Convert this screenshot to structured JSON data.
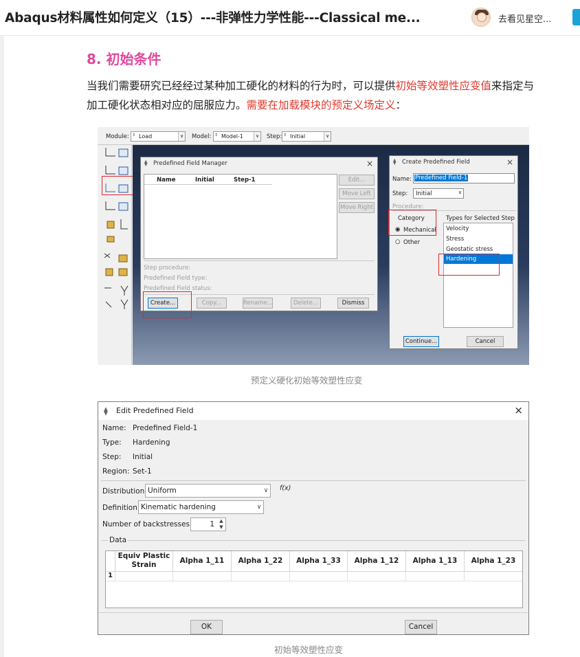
{
  "header": {
    "title": "Abaqus材料属性如何定义（15）---非弹性力学性能---Classical me...",
    "author": "去看见星空..."
  },
  "article": {
    "heading": "8. 初始条件",
    "para_1": "当我们需要研究已经经过某种加工硬化的材料的行为时，可以提供",
    "para_hl_1": "初始等效塑性应变值",
    "para_2": "来指定与加工硬化状态相对应的屈服应力。",
    "para_hl_2": "需要在加载模块的预定义场定义",
    "para_3": "：",
    "caption_1": "预定义硬化初始等效塑性应变",
    "caption_2": "初始等效塑性应变"
  },
  "shot1": {
    "module_label": "Module:",
    "module_value": "Load",
    "model_label": "Model:",
    "model_value": "Model-1",
    "step_label": "Step:",
    "step_value": "Initial",
    "manager": {
      "title": "Predefined Field Manager",
      "col_name": "Name",
      "col_initial": "Initial",
      "col_step": "Step-1",
      "btn_edit": "Edit...",
      "btn_move_left": "Move Left",
      "btn_move_right": "Move Right",
      "step_procedure": "Step procedure:",
      "field_type": "Predefined Field type:",
      "field_status": "Predefined Field status:",
      "btn_create": "Create...",
      "btn_copy": "Copy...",
      "btn_rename": "Rename...",
      "btn_delete": "Delete...",
      "btn_dismiss": "Dismiss"
    },
    "create": {
      "title": "Create Predefined Field",
      "name_label": "Name:",
      "name_value": "Predefined Field-1",
      "step_label": "Step:",
      "step_value": "Initial",
      "procedure_label": "Procedure:",
      "category_label": "Category",
      "opt_mechanical": "Mechanical",
      "opt_other": "Other",
      "types_label": "Types for Selected Step",
      "types": [
        "Velocity",
        "Stress",
        "Geostatic stress",
        "Hardening"
      ],
      "btn_continue": "Continue...",
      "btn_cancel": "Cancel"
    },
    "colors": {
      "highlight": "#0078d7",
      "annotation": "#e0262b"
    }
  },
  "shot2": {
    "title": "Edit Predefined Field",
    "name_label": "Name:",
    "name_value": "Predefined Field-1",
    "type_label": "Type:",
    "type_value": "Hardening",
    "step_label": "Step:",
    "step_value": "Initial",
    "region_label": "Region:",
    "region_value": "Set-1",
    "distribution_label": "Distribution:",
    "distribution_value": "Uniform",
    "fx": "f(x)",
    "definition_label": "Definition:",
    "definition_value": "Kinematic hardening",
    "backstress_label": "Number of backstresses:",
    "backstress_value": "1",
    "data_label": "Data",
    "columns": [
      "Equiv Plastic Strain",
      "Alpha 1_11",
      "Alpha 1_22",
      "Alpha 1_33",
      "Alpha 1_12",
      "Alpha 1_13",
      "Alpha 1_23"
    ],
    "row_number": "1",
    "btn_ok": "OK",
    "btn_cancel": "Cancel"
  }
}
